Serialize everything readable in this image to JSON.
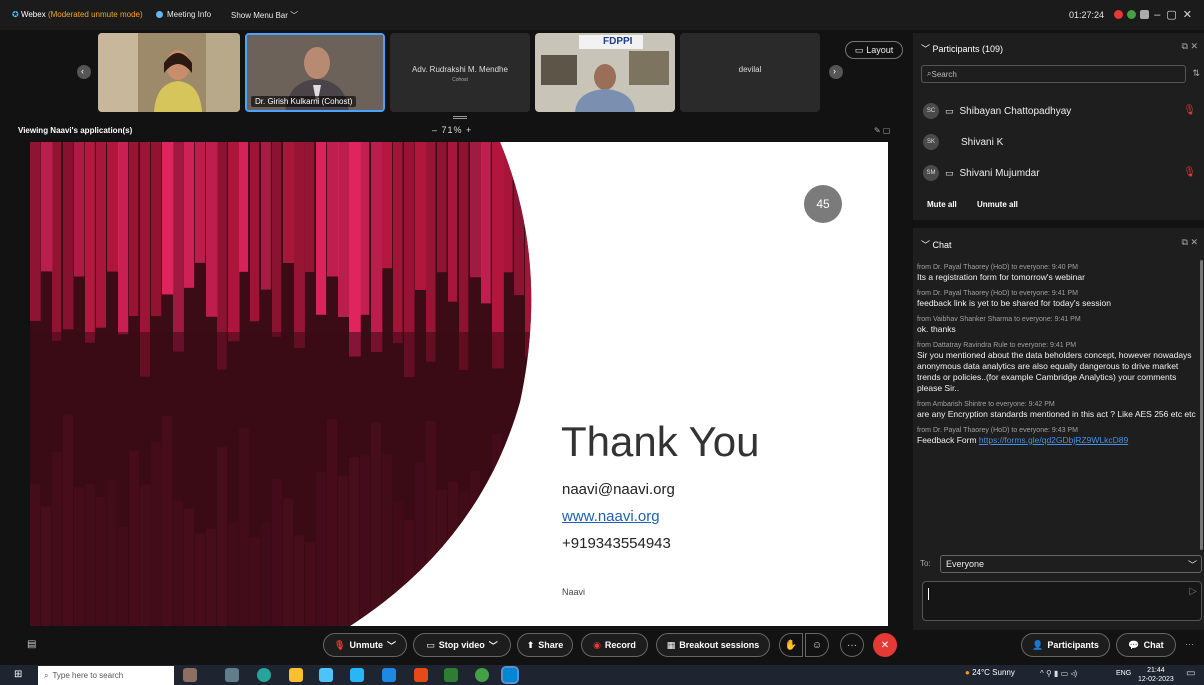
{
  "app": {
    "name": "Webex",
    "mode": "(Moderated unmute mode)",
    "meeting_info": "Meeting Info",
    "show_menu_bar": "Show Menu Bar",
    "clock": "01:27:24"
  },
  "thumbnails": [
    {
      "label": ""
    },
    {
      "label": "Dr. Girish Kulkarni (Cohost)"
    },
    {
      "name": "Adv. Rudrakshi M. Mendhe",
      "role": "Cohost"
    },
    {
      "banner": "FDPPI"
    },
    {
      "name": "devilal"
    }
  ],
  "layout_label": "Layout",
  "viewing_label": "Viewing Naavi's application(s)",
  "zoom": "71%",
  "slide": {
    "number": "45",
    "title": "Thank You",
    "email": "naavi@naavi.org",
    "website": "www.naavi.org",
    "phone": "+919343554943",
    "footer": "Naavi"
  },
  "participants": {
    "header": "Participants (109)",
    "search_placeholder": "Search",
    "list": [
      {
        "initials": "SC",
        "name": "Shibayan Chattopadhyay"
      },
      {
        "initials": "SK",
        "name": "Shivani K"
      },
      {
        "initials": "SM",
        "name": "Shivani Mujumdar"
      }
    ],
    "mute_all": "Mute all",
    "unmute_all": "Unmute all"
  },
  "chat": {
    "header": "Chat",
    "messages": [
      {
        "from": "from Dr. Payal Thaorey (HoD) to everyone:   9:40 PM",
        "text": "Its a registration form for tomorrow's webinar"
      },
      {
        "from": "from Dr. Payal Thaorey (HoD) to everyone:   9:41 PM",
        "text": "feedback link is yet to be shared for today's session"
      },
      {
        "from": "from Vaibhav Shanker Sharma to everyone:   9:41 PM",
        "text": "ok. thanks"
      },
      {
        "from": "from Dattatray Ravindra Rule to everyone:   9:41 PM",
        "text": "Sir you mentioned about the data beholders concept, however nowadays anonymous data analytics are also  equally dangerous to drive market trends or policies..(for example Cambridge Analytics)  your comments  please Sir.."
      },
      {
        "from": "from Ambarish Shintre to everyone:   9:42 PM",
        "text": "are any Encryption standards mentioned in this act ? Like AES 256 etc etc"
      },
      {
        "from": "from Dr. Payal Thaorey (HoD) to everyone:   9:43 PM",
        "text": "Feedback Form ",
        "link": "https://forms.gle/qd2GDbjRZ9WLkcD89"
      }
    ],
    "to_label": "To:",
    "to_value": "Everyone"
  },
  "controls": {
    "unmute": "Unmute",
    "stop_video": "Stop video",
    "share": "Share",
    "record": "Record",
    "breakout": "Breakout sessions",
    "participants": "Participants",
    "chat": "Chat"
  },
  "taskbar": {
    "search_placeholder": "Type here to search",
    "weather": "24°C  Sunny",
    "lang": "ENG",
    "time": "21:44",
    "date": "12-02-2023"
  },
  "colors": {
    "accent_red": "#e53935",
    "link_blue": "#4a90e2",
    "slide_dark": "#3a0a16",
    "slide_pink": "#e0245e"
  }
}
